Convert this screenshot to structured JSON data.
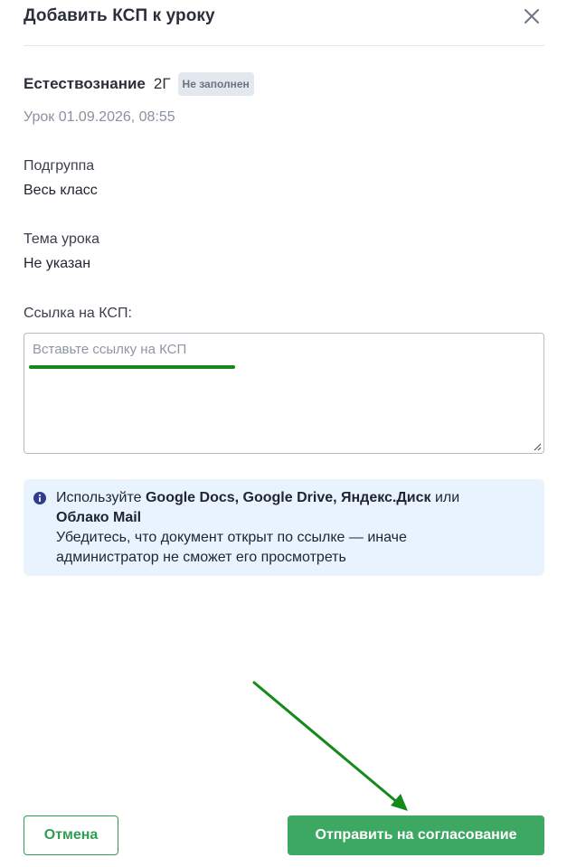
{
  "dialog": {
    "title": "Добавить КСП к уроку",
    "close_icon": "close-icon"
  },
  "lesson": {
    "subject": "Естествознание",
    "class_name": "2Г",
    "status_badge": "Не заполнен",
    "date_line": "Урок 01.09.2026, 08:55"
  },
  "fields": {
    "subgroup_label": "Подгруппа",
    "subgroup_value": "Весь класс",
    "topic_label": "Тема урока",
    "topic_value": "Не указан",
    "link_label": "Ссылка на КСП:",
    "link_placeholder": "Вставьте ссылку на КСП",
    "link_value": ""
  },
  "info": {
    "icon": "info-icon",
    "line1_prefix": "Используйте ",
    "line1_services": "Google Docs, Google Drive, Яндекс.Диск",
    "line1_or": " или",
    "line2_service": "Облако Mail",
    "line3": "Убедитесь, что документ открыт по ссылке — иначе",
    "line4": "администратор не сможет его просмотреть"
  },
  "buttons": {
    "cancel_label": "Отмена",
    "submit_label": "Отправить на согласование"
  },
  "colors": {
    "accent_green": "#3da862",
    "annotation_green": "#148a1a",
    "info_background": "#e8f3fd",
    "badge_background": "#e3e7ee"
  }
}
